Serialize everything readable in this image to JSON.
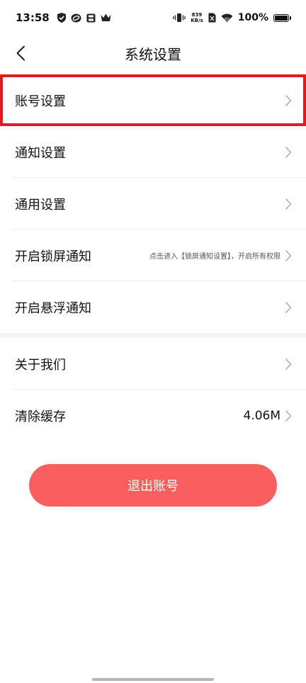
{
  "status_bar": {
    "time": "13:58",
    "net_speed_value": "839",
    "net_speed_unit": "KB/s",
    "battery_percent": "100%",
    "battery_level": 1.0,
    "icons": [
      "shield-check-icon",
      "swirl-app-icon",
      "save-box-icon",
      "crown-icon",
      "vibrate-icon",
      "no-sim-icon",
      "wifi-icon",
      "battery-icon"
    ]
  },
  "header": {
    "title": "系统设置",
    "back_icon": "chevron-left-icon"
  },
  "settings": {
    "items": [
      {
        "label": "账号设置"
      },
      {
        "label": "通知设置"
      },
      {
        "label": "通用设置"
      },
      {
        "label": "开启锁屏通知",
        "hint": "点击进入【锁屏通知设置】，开启所有权限"
      },
      {
        "label": "开启悬浮通知"
      },
      {
        "label": "关于我们"
      },
      {
        "label": "清除缓存",
        "value": "4.06M"
      }
    ]
  },
  "actions": {
    "logout_label": "退出账号"
  },
  "colors": {
    "accent": "#fb5e5e",
    "highlight_border": "#e11b22",
    "section_gap": "#f4f4f6",
    "chevron": "#a8a8a8"
  }
}
